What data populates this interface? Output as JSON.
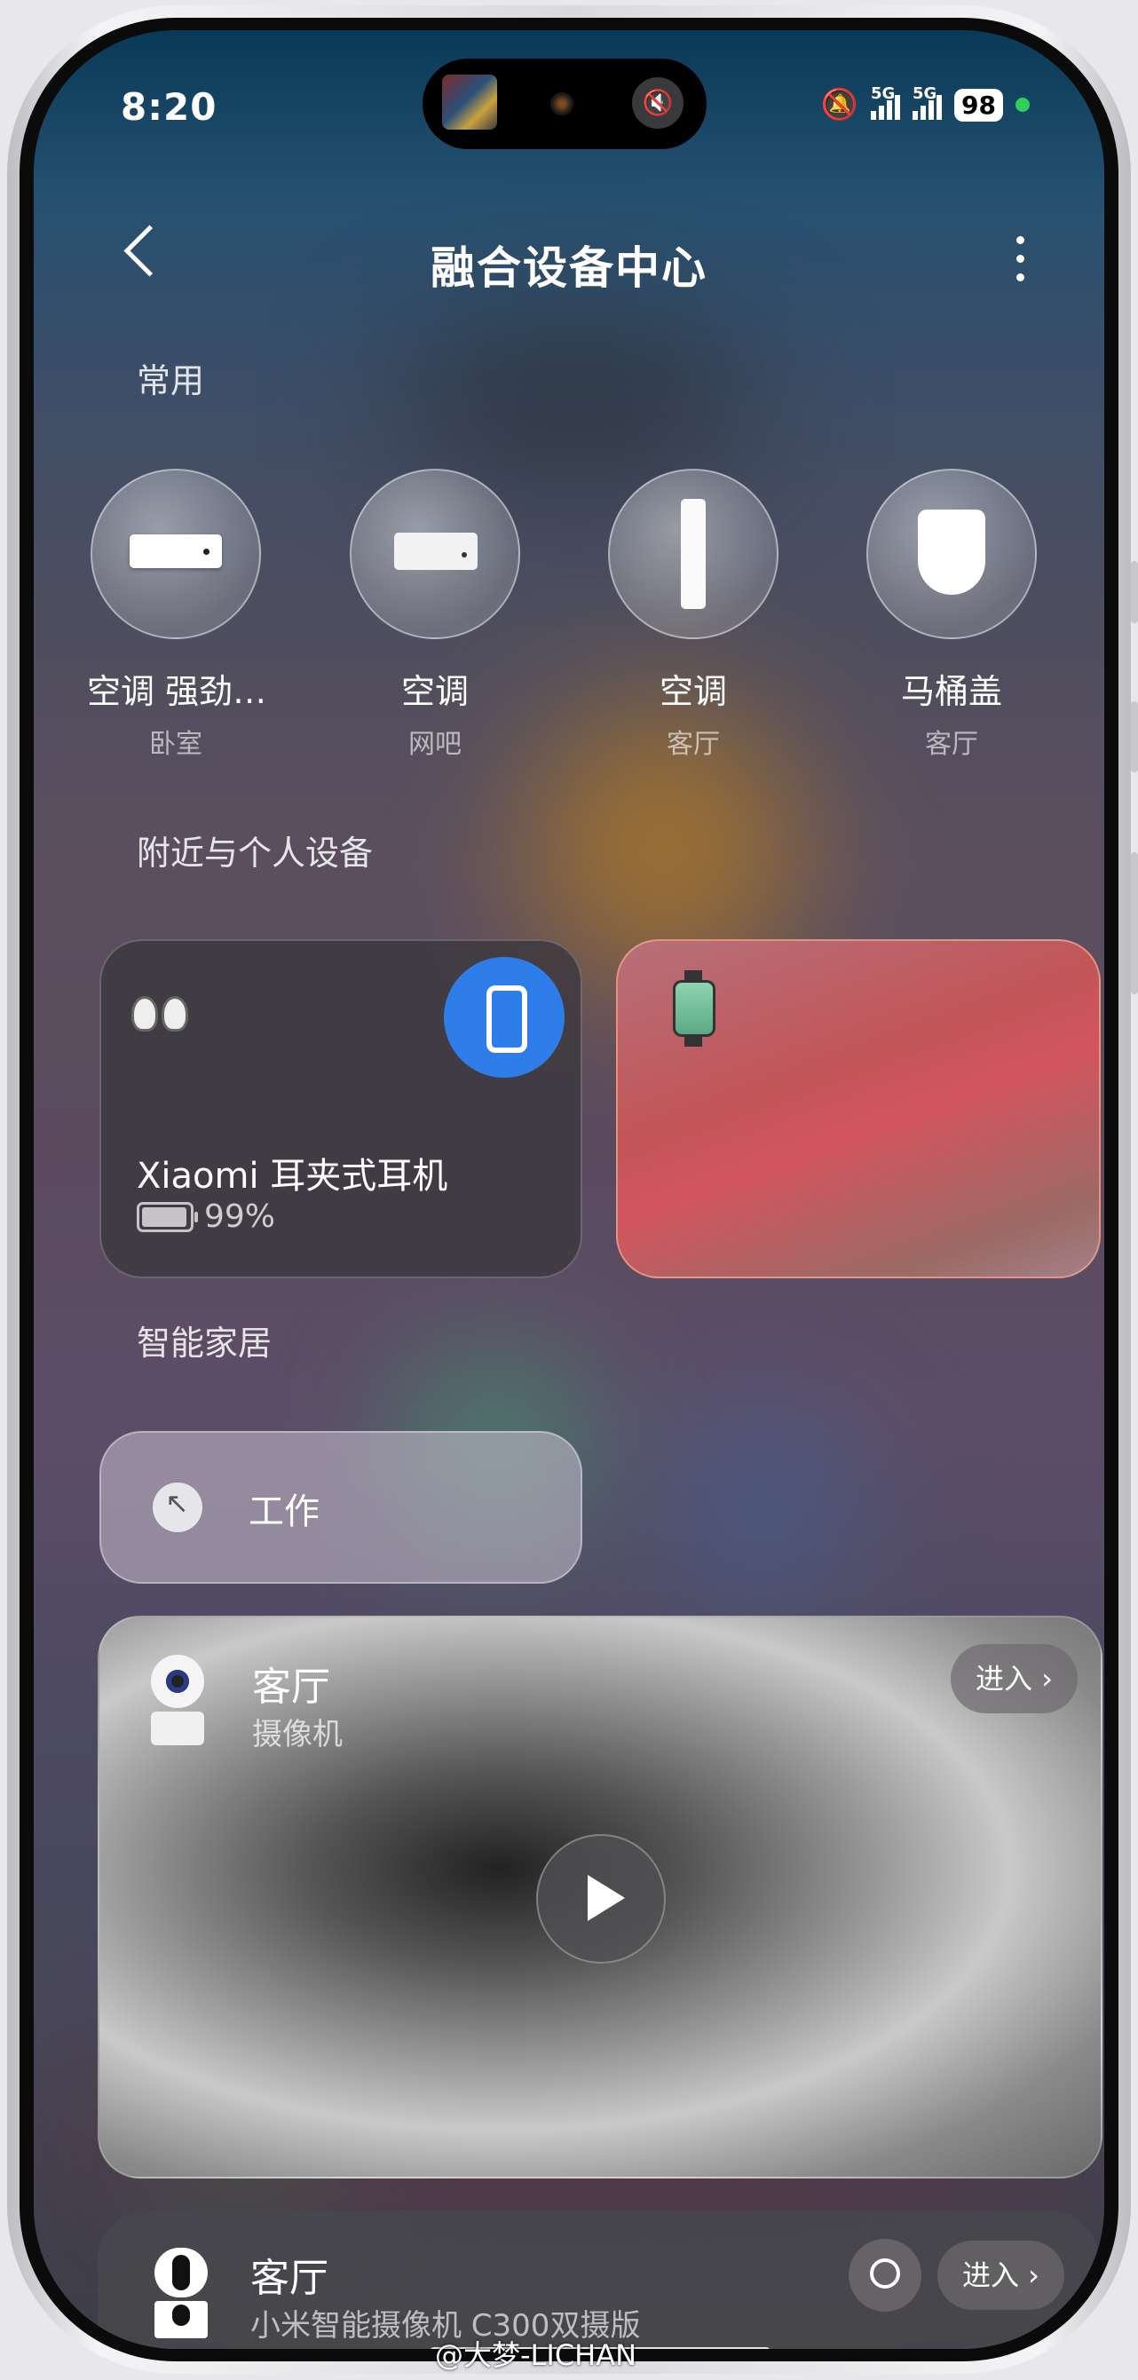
{
  "status": {
    "time": "8:20",
    "net1": "5G",
    "net2": "5G",
    "battery": "98"
  },
  "header": {
    "title": "融合设备中心"
  },
  "sections": {
    "frequent": "常用",
    "nearby": "附近与个人设备",
    "smart_home": "智能家居"
  },
  "frequent": [
    {
      "name": "空调 强劲…",
      "room": "卧室",
      "icon": "air-conditioner-icon"
    },
    {
      "name": "空调",
      "room": "网吧",
      "icon": "air-conditioner-icon"
    },
    {
      "name": "空调",
      "room": "客厅",
      "icon": "tower-air-conditioner-icon"
    },
    {
      "name": "马桶盖",
      "room": "客厅",
      "icon": "toilet-seat-icon"
    }
  ],
  "nearby": {
    "earphones": {
      "name": "Xiaomi 耳夹式耳机",
      "battery": "99%"
    }
  },
  "scene": {
    "label": "工作"
  },
  "camera_card": {
    "title": "客厅",
    "subtitle": "摄像机",
    "enter": "进入 ›"
  },
  "bottom_card": {
    "title": "客厅",
    "subtitle": "小米智能摄像机 C300双摄版",
    "enter": "进入 ›"
  },
  "watermark": "@大梦-LICHAN"
}
